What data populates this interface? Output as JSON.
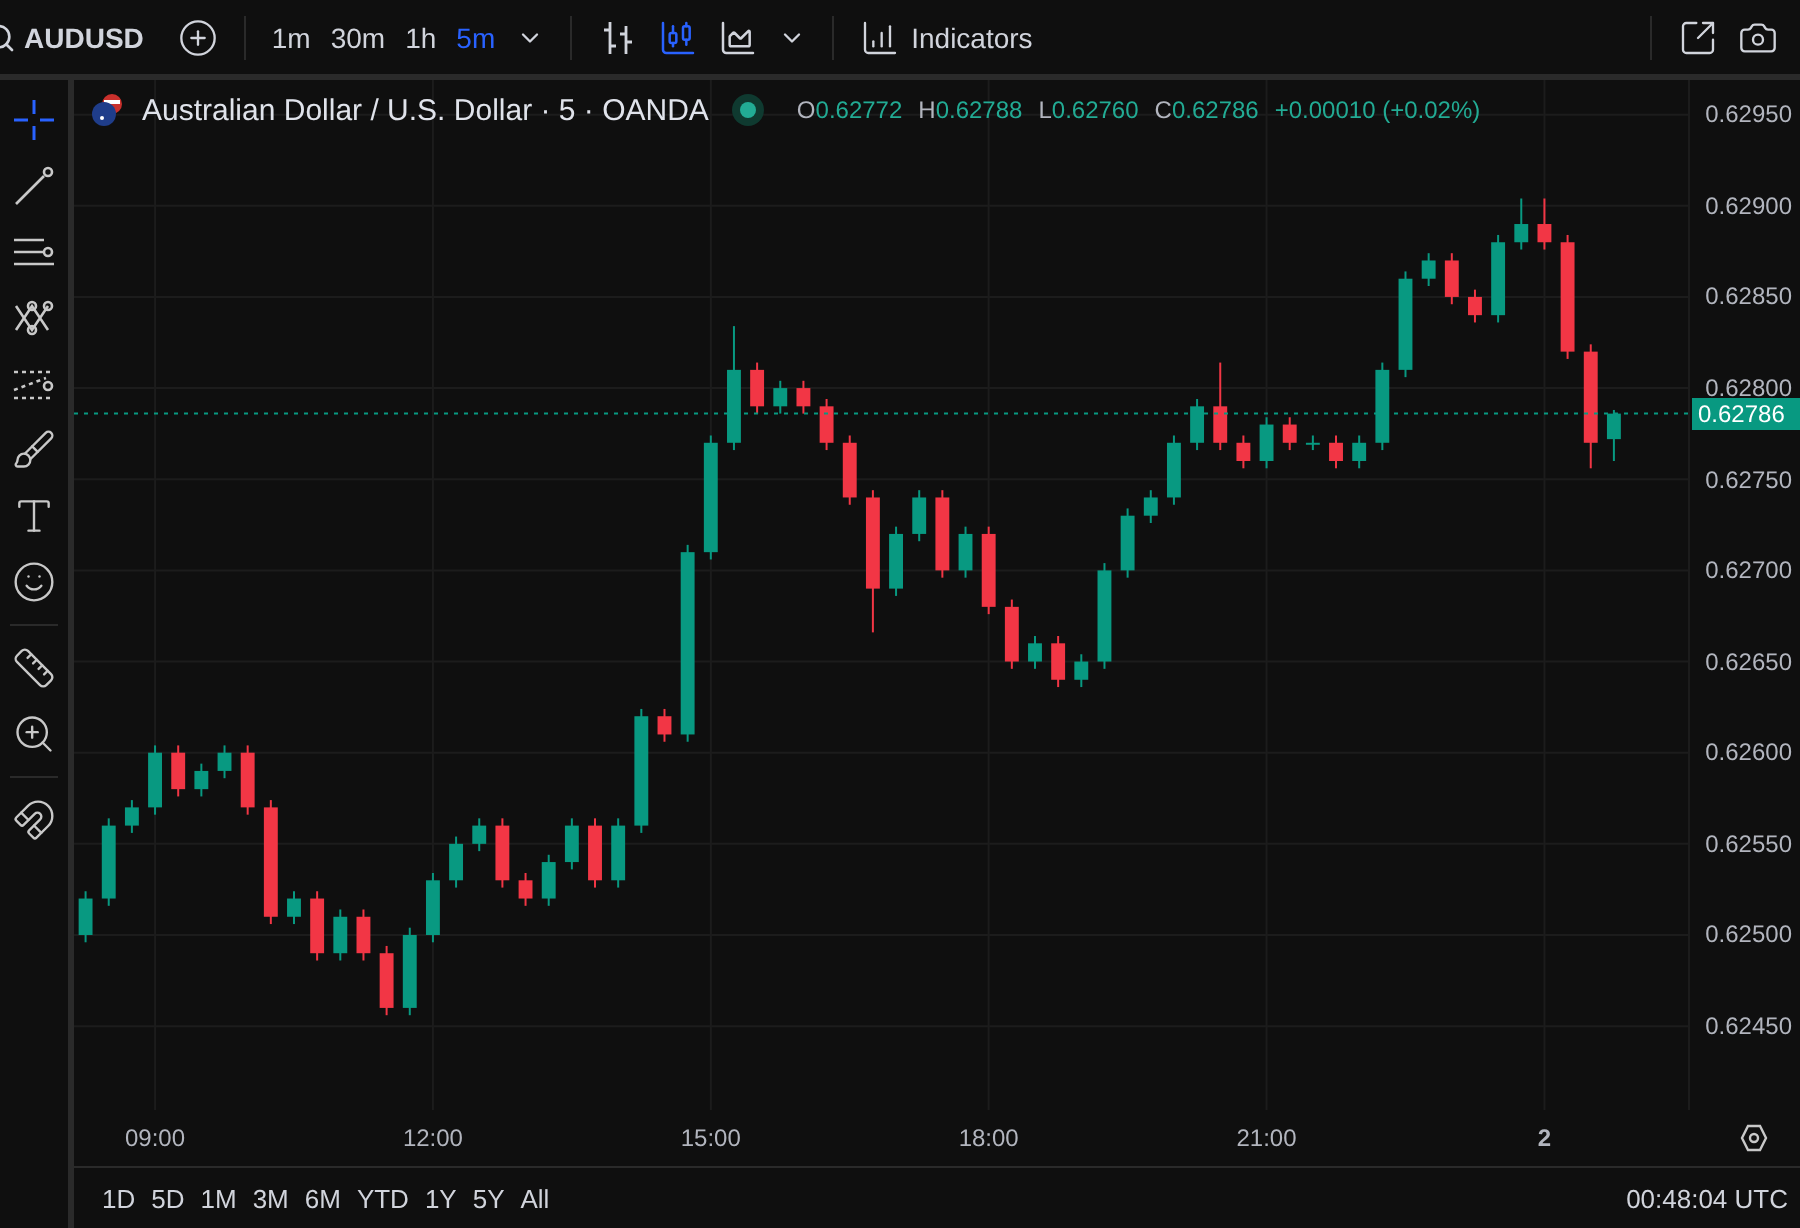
{
  "toolbar": {
    "symbol": "AUDUSD",
    "intervals": [
      {
        "label": "1m",
        "selected": false
      },
      {
        "label": "30m",
        "selected": false
      },
      {
        "label": "1h",
        "selected": false
      },
      {
        "label": "5m",
        "selected": true
      }
    ],
    "chart_types": [
      {
        "kind": "bars",
        "selected": false
      },
      {
        "kind": "candles",
        "selected": true
      },
      {
        "kind": "area",
        "selected": false
      }
    ],
    "indicators": "Indicators"
  },
  "left_tools": [
    {
      "kind": "crosshair",
      "selected": true
    },
    {
      "kind": "trend-line",
      "selected": false
    },
    {
      "kind": "fib",
      "selected": false
    },
    {
      "kind": "pattern",
      "selected": false
    },
    {
      "kind": "projection",
      "selected": false
    },
    {
      "kind": "brush",
      "selected": false
    },
    {
      "kind": "text",
      "selected": false
    },
    {
      "kind": "emoji",
      "selected": false
    },
    {
      "kind": "ruler",
      "selected": false
    },
    {
      "kind": "zoom",
      "selected": false
    },
    {
      "kind": "magnet",
      "selected": false
    }
  ],
  "legend": {
    "title": "Australian Dollar / U.S. Dollar · 5 · OANDA",
    "ohlc": [
      {
        "label": "O",
        "value": "0.62772"
      },
      {
        "label": "H",
        "value": "0.62788"
      },
      {
        "label": "L",
        "value": "0.62760"
      },
      {
        "label": "C",
        "value": "0.62786"
      }
    ],
    "change": "+0.00010 (+0.02%)"
  },
  "chart_data": {
    "type": "candlestick",
    "ylim": [
      0.62404,
      0.62969
    ],
    "grid": true,
    "ref_lines": [
      {
        "axis": "y",
        "value": 0.62786,
        "color": "#089981",
        "label": "0.62786"
      }
    ],
    "yticks": [
      {
        "value": 0.6295,
        "label": "0.62950"
      },
      {
        "value": 0.629,
        "label": "0.62900"
      },
      {
        "value": 0.6285,
        "label": "0.62850"
      },
      {
        "value": 0.628,
        "label": "0.62800"
      },
      {
        "value": 0.6275,
        "label": "0.62750"
      },
      {
        "value": 0.627,
        "label": "0.62700"
      },
      {
        "value": 0.6265,
        "label": "0.62650"
      },
      {
        "value": 0.626,
        "label": "0.62600"
      },
      {
        "value": 0.6255,
        "label": "0.62550"
      },
      {
        "value": 0.625,
        "label": "0.62500"
      },
      {
        "value": 0.6245,
        "label": "0.62450"
      }
    ],
    "categories": [
      null,
      null,
      null,
      "09:00",
      null,
      null,
      null,
      null,
      null,
      null,
      null,
      null,
      null,
      null,
      null,
      "12:00",
      null,
      null,
      null,
      null,
      null,
      null,
      null,
      null,
      null,
      null,
      null,
      "15:00",
      null,
      null,
      null,
      null,
      null,
      null,
      null,
      null,
      null,
      null,
      null,
      "18:00",
      null,
      null,
      null,
      null,
      null,
      null,
      null,
      null,
      null,
      null,
      null,
      "21:00",
      null,
      null,
      null,
      null,
      null,
      null,
      null,
      null,
      null,
      null,
      null,
      "2",
      null,
      null,
      null
    ],
    "ohlc": [
      [
        0.625,
        0.62524,
        0.62496,
        0.6252
      ],
      [
        0.6252,
        0.62564,
        0.62516,
        0.6256
      ],
      [
        0.6256,
        0.62574,
        0.62556,
        0.6257
      ],
      [
        0.6257,
        0.62604,
        0.62566,
        0.626
      ],
      [
        0.626,
        0.62604,
        0.62576,
        0.6258
      ],
      [
        0.6258,
        0.62594,
        0.62576,
        0.6259
      ],
      [
        0.6259,
        0.62604,
        0.62586,
        0.626
      ],
      [
        0.626,
        0.62604,
        0.62566,
        0.6257
      ],
      [
        0.6257,
        0.62574,
        0.62506,
        0.6251
      ],
      [
        0.6251,
        0.62524,
        0.62506,
        0.6252
      ],
      [
        0.6252,
        0.62524,
        0.62486,
        0.6249
      ],
      [
        0.6249,
        0.62514,
        0.62486,
        0.6251
      ],
      [
        0.6251,
        0.62514,
        0.62486,
        0.6249
      ],
      [
        0.6249,
        0.62494,
        0.62456,
        0.6246
      ],
      [
        0.6246,
        0.62504,
        0.62456,
        0.625
      ],
      [
        0.625,
        0.62534,
        0.62496,
        0.6253
      ],
      [
        0.6253,
        0.62554,
        0.62526,
        0.6255
      ],
      [
        0.6255,
        0.62564,
        0.62546,
        0.6256
      ],
      [
        0.6256,
        0.62564,
        0.62526,
        0.6253
      ],
      [
        0.6253,
        0.62534,
        0.62516,
        0.6252
      ],
      [
        0.6252,
        0.62544,
        0.62516,
        0.6254
      ],
      [
        0.6254,
        0.62564,
        0.62536,
        0.6256
      ],
      [
        0.6256,
        0.62564,
        0.62526,
        0.6253
      ],
      [
        0.6253,
        0.62564,
        0.62526,
        0.6256
      ],
      [
        0.6256,
        0.62624,
        0.62556,
        0.6262
      ],
      [
        0.6262,
        0.62624,
        0.62606,
        0.6261
      ],
      [
        0.6261,
        0.62714,
        0.62606,
        0.6271
      ],
      [
        0.6271,
        0.62774,
        0.62706,
        0.6277
      ],
      [
        0.6277,
        0.62834,
        0.62766,
        0.6281
      ],
      [
        0.6281,
        0.62814,
        0.62786,
        0.6279
      ],
      [
        0.6279,
        0.62804,
        0.62786,
        0.628
      ],
      [
        0.628,
        0.62804,
        0.62786,
        0.6279
      ],
      [
        0.6279,
        0.62794,
        0.62766,
        0.6277
      ],
      [
        0.6277,
        0.62774,
        0.62736,
        0.6274
      ],
      [
        0.6274,
        0.62744,
        0.62666,
        0.6269
      ],
      [
        0.6269,
        0.62724,
        0.62686,
        0.6272
      ],
      [
        0.6272,
        0.62744,
        0.62716,
        0.6274
      ],
      [
        0.6274,
        0.62744,
        0.62696,
        0.627
      ],
      [
        0.627,
        0.62724,
        0.62696,
        0.6272
      ],
      [
        0.6272,
        0.62724,
        0.62676,
        0.6268
      ],
      [
        0.6268,
        0.62684,
        0.62646,
        0.6265
      ],
      [
        0.6265,
        0.62664,
        0.62646,
        0.6266
      ],
      [
        0.6266,
        0.62664,
        0.62636,
        0.6264
      ],
      [
        0.6264,
        0.62654,
        0.62636,
        0.6265
      ],
      [
        0.6265,
        0.62704,
        0.62646,
        0.627
      ],
      [
        0.627,
        0.62734,
        0.62696,
        0.6273
      ],
      [
        0.6273,
        0.62744,
        0.62726,
        0.6274
      ],
      [
        0.6274,
        0.62774,
        0.62736,
        0.6277
      ],
      [
        0.6277,
        0.62794,
        0.62766,
        0.6279
      ],
      [
        0.6279,
        0.62814,
        0.62766,
        0.6277
      ],
      [
        0.6277,
        0.62774,
        0.62756,
        0.6276
      ],
      [
        0.6276,
        0.62784,
        0.62756,
        0.6278
      ],
      [
        0.6278,
        0.62784,
        0.62766,
        0.6277
      ],
      [
        0.6277,
        0.62774,
        0.62766,
        0.6277
      ],
      [
        0.6277,
        0.62774,
        0.62756,
        0.6276
      ],
      [
        0.6276,
        0.62774,
        0.62756,
        0.6277
      ],
      [
        0.6277,
        0.62814,
        0.62766,
        0.6281
      ],
      [
        0.6281,
        0.62864,
        0.62806,
        0.6286
      ],
      [
        0.6286,
        0.62874,
        0.62856,
        0.6287
      ],
      [
        0.6287,
        0.62874,
        0.62846,
        0.6285
      ],
      [
        0.6285,
        0.62854,
        0.62836,
        0.6284
      ],
      [
        0.6284,
        0.62884,
        0.62836,
        0.6288
      ],
      [
        0.6288,
        0.62904,
        0.62876,
        0.6289
      ],
      [
        0.6289,
        0.62904,
        0.62876,
        0.6288
      ],
      [
        0.6288,
        0.62884,
        0.62816,
        0.6282
      ],
      [
        0.6282,
        0.62824,
        0.62756,
        0.6277
      ],
      [
        0.62772,
        0.62788,
        0.6276,
        0.62786
      ]
    ]
  },
  "ranges": [
    {
      "label": "1D"
    },
    {
      "label": "5D"
    },
    {
      "label": "1M"
    },
    {
      "label": "3M"
    },
    {
      "label": "6M"
    },
    {
      "label": "YTD"
    },
    {
      "label": "1Y"
    },
    {
      "label": "5Y"
    },
    {
      "label": "All"
    }
  ],
  "clock": "00:48:04 UTC"
}
